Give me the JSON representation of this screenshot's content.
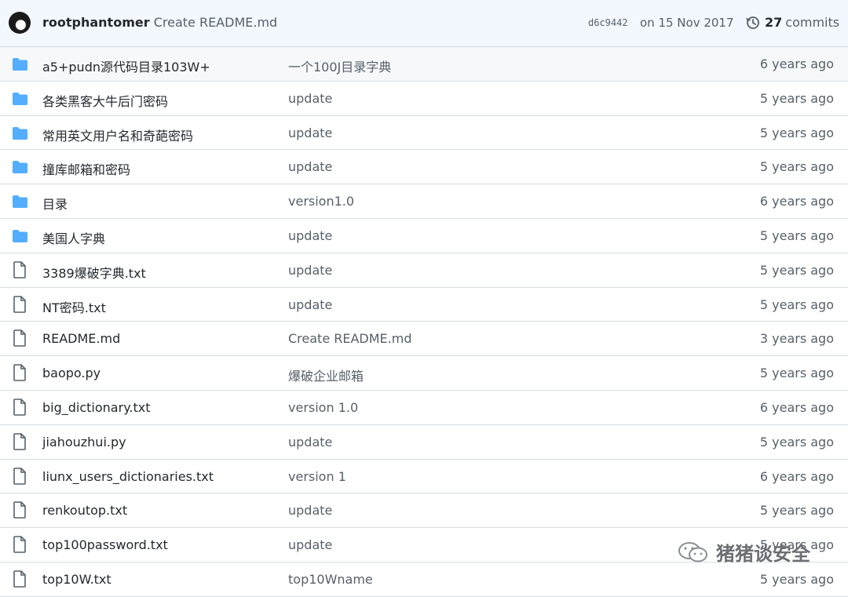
{
  "header": {
    "author": "rootphantomer",
    "message": "Create README.md",
    "sha": "d6c9442",
    "date": "on 15 Nov 2017",
    "commit_count": "27",
    "commits_label": "commits"
  },
  "rows": [
    {
      "type": "folder",
      "icon": "folder-icon",
      "name": "a5+pudn源代码目录103W+",
      "message": "一个100J目录字典",
      "age": "6 years ago"
    },
    {
      "type": "folder",
      "icon": "folder-icon",
      "name": "各类黑客大牛后门密码",
      "message": "update",
      "age": "5 years ago"
    },
    {
      "type": "folder",
      "icon": "folder-icon",
      "name": "常用英文用户名和奇葩密码",
      "message": "update",
      "age": "5 years ago"
    },
    {
      "type": "folder",
      "icon": "folder-icon",
      "name": "撞库邮箱和密码",
      "message": "update",
      "age": "5 years ago"
    },
    {
      "type": "folder",
      "icon": "folder-icon",
      "name": "目录",
      "message": "version1.0",
      "age": "6 years ago"
    },
    {
      "type": "folder",
      "icon": "folder-icon",
      "name": "美国人字典",
      "message": "update",
      "age": "5 years ago"
    },
    {
      "type": "file",
      "icon": "file-icon",
      "name": "3389爆破字典.txt",
      "message": "update",
      "age": "5 years ago"
    },
    {
      "type": "file",
      "icon": "file-icon",
      "name": "NT密码.txt",
      "message": "update",
      "age": "5 years ago"
    },
    {
      "type": "file",
      "icon": "file-icon",
      "name": "README.md",
      "message": "Create README.md",
      "age": "3 years ago"
    },
    {
      "type": "file",
      "icon": "file-icon",
      "name": "baopo.py",
      "message": "爆破企业邮箱",
      "age": "5 years ago"
    },
    {
      "type": "file",
      "icon": "file-icon",
      "name": "big_dictionary.txt",
      "message": "version 1.0",
      "age": "6 years ago"
    },
    {
      "type": "file",
      "icon": "file-icon",
      "name": "jiahouzhui.py",
      "message": "update",
      "age": "5 years ago"
    },
    {
      "type": "file",
      "icon": "file-icon",
      "name": "liunx_users_dictionaries.txt",
      "message": "version 1",
      "age": "6 years ago"
    },
    {
      "type": "file",
      "icon": "file-icon",
      "name": "renkoutop.txt",
      "message": "update",
      "age": "5 years ago"
    },
    {
      "type": "file",
      "icon": "file-icon",
      "name": "top100password.txt",
      "message": "update",
      "age": "5 years ago"
    },
    {
      "type": "file",
      "icon": "file-icon",
      "name": "top10W.txt",
      "message": "top10Wname",
      "age": "5 years ago"
    }
  ],
  "watermark": {
    "text": "猪猪谈安全",
    "icon": "wechat-icon"
  },
  "colors": {
    "folder": "#54aeff",
    "file": "#57606a",
    "header_bg": "#f3f7fe"
  }
}
